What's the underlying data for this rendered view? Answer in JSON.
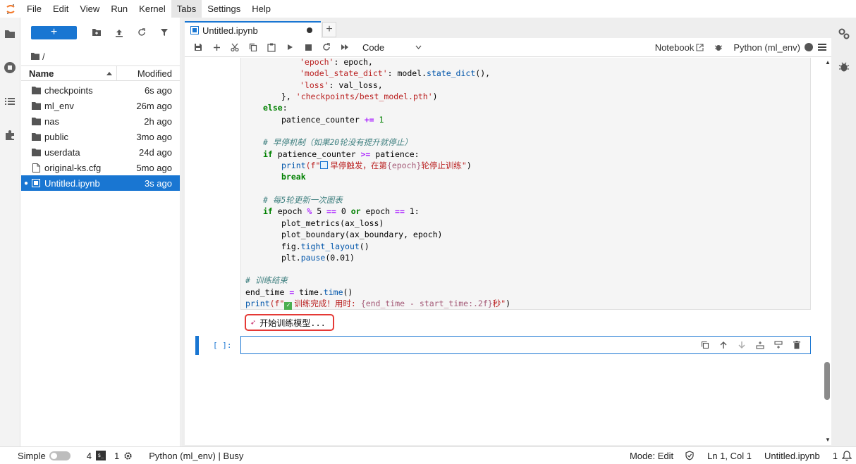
{
  "menubar": {
    "items": [
      "File",
      "Edit",
      "View",
      "Run",
      "Kernel",
      "Tabs",
      "Settings",
      "Help"
    ],
    "active": "Tabs"
  },
  "filebrowser": {
    "path": "/",
    "col_name": "Name",
    "col_modified": "Modified",
    "files": [
      {
        "name": "checkpoints",
        "modified": "6s ago",
        "type": "folder"
      },
      {
        "name": "ml_env",
        "modified": "26m ago",
        "type": "folder"
      },
      {
        "name": "nas",
        "modified": "2h ago",
        "type": "folder"
      },
      {
        "name": "public",
        "modified": "3mo ago",
        "type": "folder"
      },
      {
        "name": "userdata",
        "modified": "24d ago",
        "type": "folder"
      },
      {
        "name": "original-ks.cfg",
        "modified": "5mo ago",
        "type": "file"
      },
      {
        "name": "Untitled.ipynb",
        "modified": "3s ago",
        "type": "notebook",
        "selected": true
      }
    ]
  },
  "tab": {
    "label": "Untitled.ipynb",
    "add": "+"
  },
  "toolbar": {
    "cell_type": "Code",
    "notebook_link": "Notebook",
    "kernel": "Python (ml_env)"
  },
  "code": {
    "l1_key": "'epoch'",
    "l1_rest": ": epoch,",
    "l2_key": "'model_state_dict'",
    "l2_rest": ": model.",
    "l2_fn": "state_dict",
    "l2_end": "(),",
    "l3_key": "'loss'",
    "l3_rest": ": val_loss,",
    "l4_pre": "}, ",
    "l4_str": "'checkpoints/best_model.pth'",
    "l4_end": ")",
    "l5_kw": "else",
    "l5_end": ":",
    "l6": "patience_counter ",
    "l6_op": "+=",
    "l6_num": " 1",
    "l8_cm": "# 早停机制（如果20轮没有提升就停止）",
    "l9_kw": "if",
    "l9_mid": " patience_counter ",
    "l9_op": ">=",
    "l9_end": " patience:",
    "l10_fn": "print",
    "l10_f": "(f\"",
    "l10_str1": "早停触发，在第",
    "l10_var": "{epoch}",
    "l10_str2": "轮停止训练\"",
    "l10_end": ")",
    "l11_kw": "break",
    "l13_cm": "# 每5轮更新一次图表",
    "l14_kw": "if",
    "l14_a": " epoch ",
    "l14_op1": "%",
    "l14_b": " 5 ",
    "l14_op2": "==",
    "l14_c": " 0 ",
    "l14_kw2": "or",
    "l14_d": " epoch ",
    "l14_op3": "==",
    "l14_e": " 1:",
    "l15": "plot_metrics(ax_loss)",
    "l16": "plot_boundary(ax_boundary, epoch)",
    "l17_pre": "fig.",
    "l17_fn": "tight_layout",
    "l17_end": "()",
    "l18_pre": "plt.",
    "l18_fn": "pause",
    "l18_end": "(0.01)",
    "l20_cm": "# 训练结束",
    "l21_pre": "end_time ",
    "l21_op": "=",
    "l21_mid": " time.",
    "l21_fn": "time",
    "l21_end": "()",
    "l22_fn": "print",
    "l22_f": "(f\"",
    "l22_str1": "训练完成！用时: ",
    "l22_var": "{end_time - start_time:.2f}",
    "l22_str2": "秒\"",
    "l22_end": ")"
  },
  "output": {
    "text": "开始训练模型..."
  },
  "empty_cell": {
    "prompt": "[ ]:"
  },
  "statusbar": {
    "simple": "Simple",
    "terminals": "4",
    "kernels": "1",
    "kernel_status": "Python (ml_env) | Busy",
    "mode": "Mode: Edit",
    "position": "Ln 1, Col 1",
    "file": "Untitled.ipynb",
    "notifications": "1"
  }
}
